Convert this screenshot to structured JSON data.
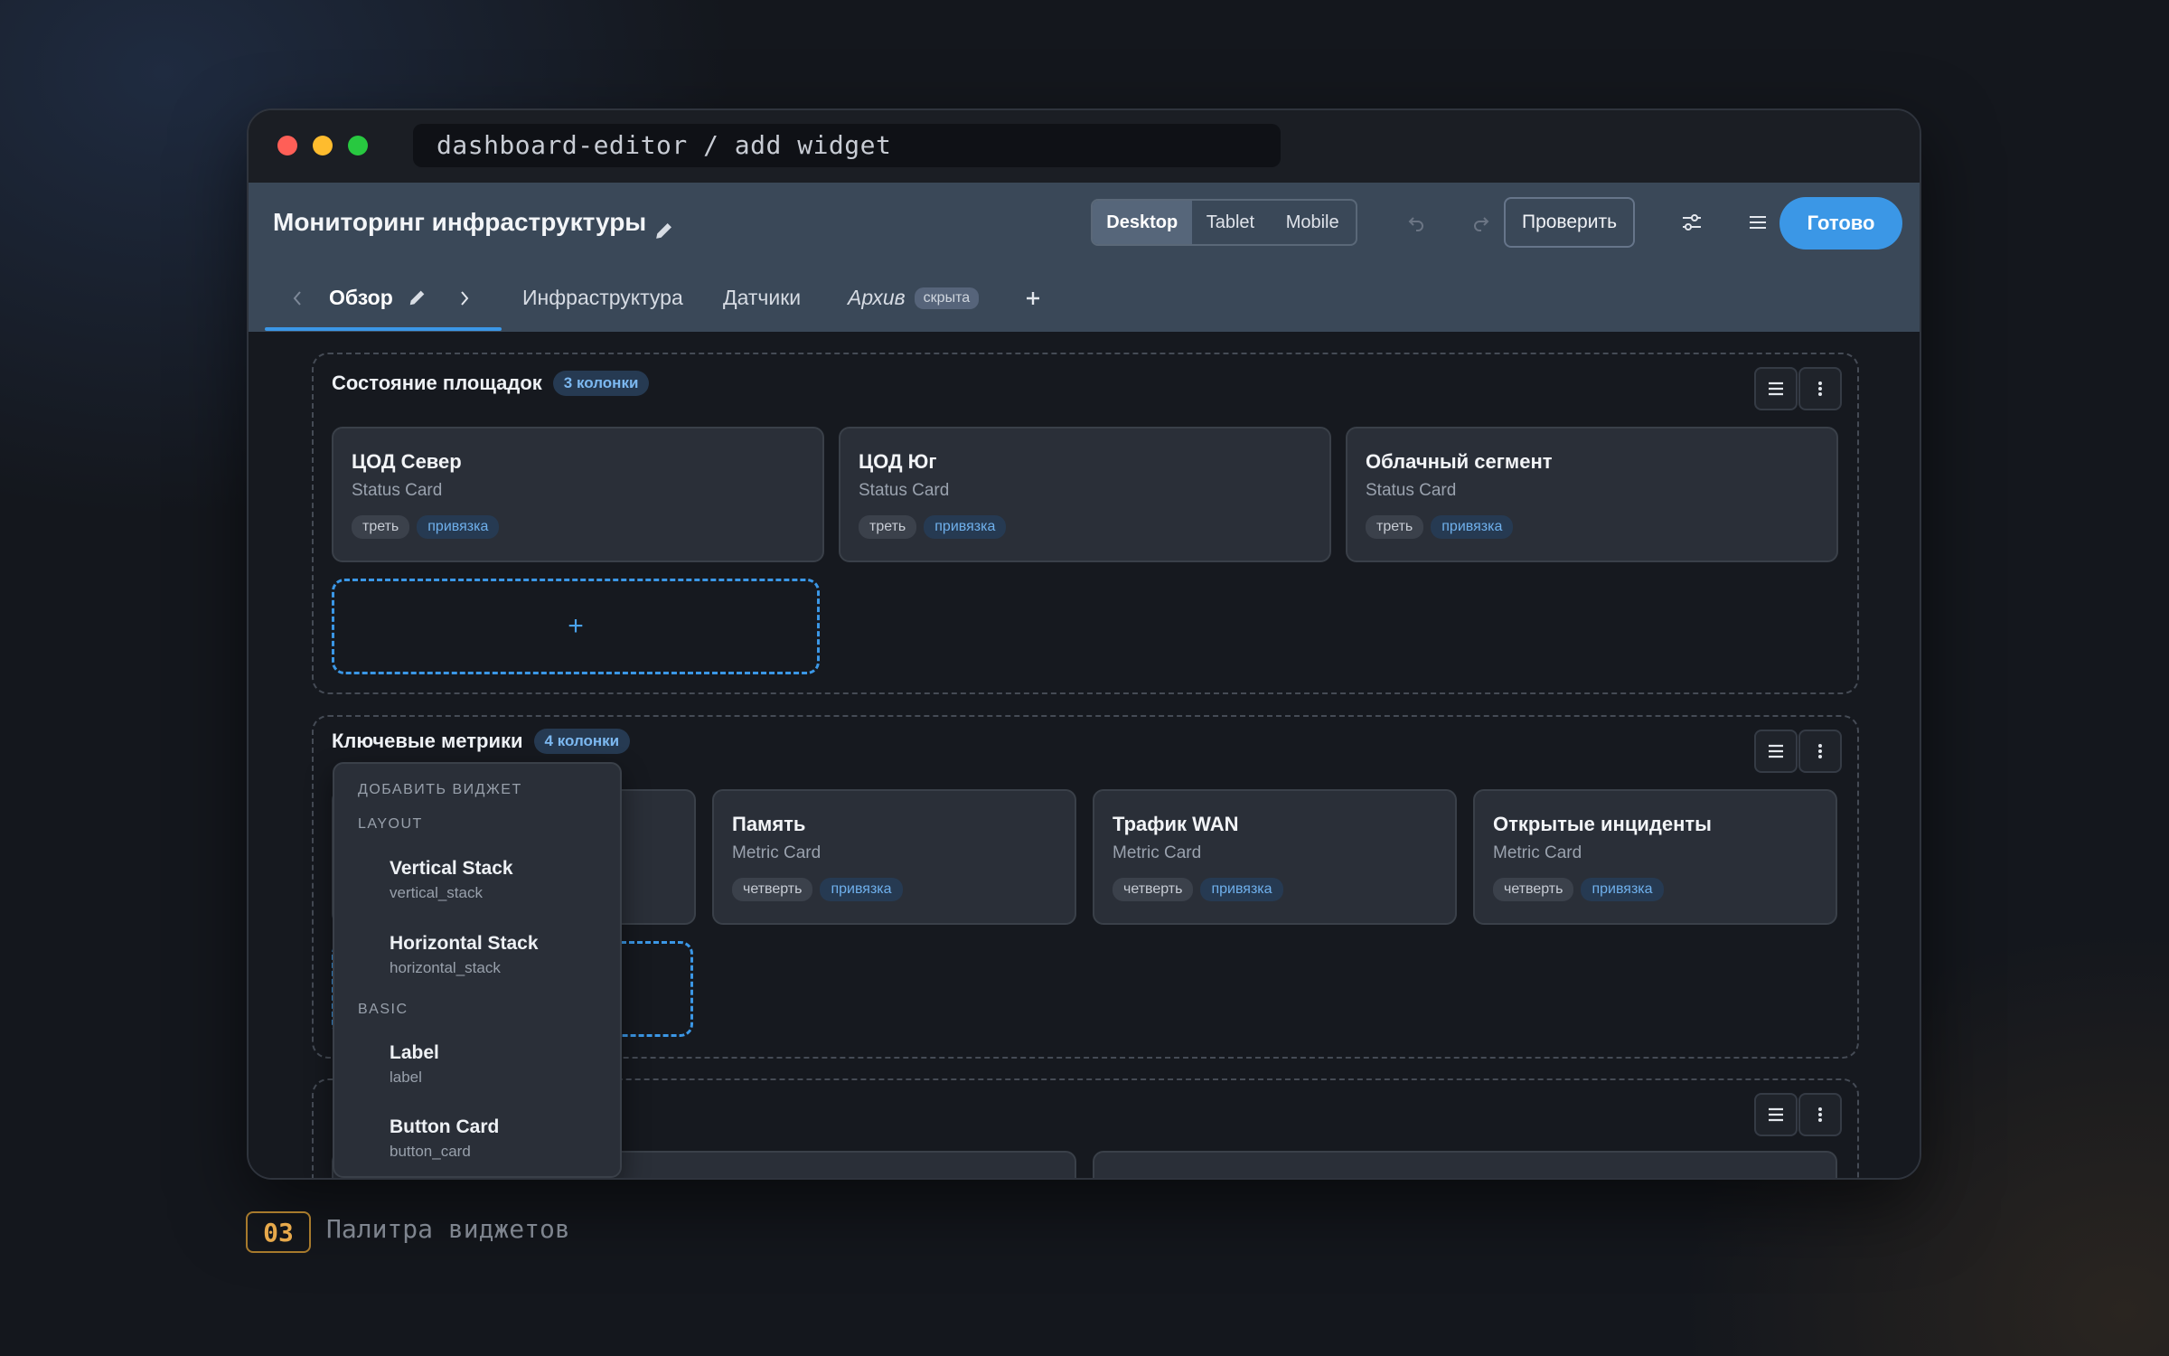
{
  "window": {
    "address": "dashboard-editor / add widget"
  },
  "header": {
    "title": "Мониторинг инфраструктуры",
    "devices": [
      "Desktop",
      "Tablet",
      "Mobile"
    ],
    "check_label": "Проверить",
    "done_label": "Готово"
  },
  "tabs": {
    "active": "Обзор",
    "items": [
      "Инфраструктура",
      "Датчики",
      "Архив"
    ],
    "hidden_badge": "скрыта"
  },
  "sections": [
    {
      "title": "Состояние площадок",
      "badge": "3 колонки",
      "cards": [
        {
          "title": "ЦОД Север",
          "type": "Status Card",
          "size": "треть",
          "binding": "привязка"
        },
        {
          "title": "ЦОД Юг",
          "type": "Status Card",
          "size": "треть",
          "binding": "привязка"
        },
        {
          "title": "Облачный сегмент",
          "type": "Status Card",
          "size": "треть",
          "binding": "привязка"
        }
      ],
      "add": "+"
    },
    {
      "title": "Ключевые метрики",
      "badge": "4 колонки",
      "cards": [
        {
          "title": "Память",
          "type": "Metric Card",
          "size": "четверть",
          "binding": "привязка"
        },
        {
          "title": "Трафик WAN",
          "type": "Metric Card",
          "size": "четверть",
          "binding": "привязка"
        },
        {
          "title": "Открытые инциденты",
          "type": "Metric Card",
          "size": "четверть",
          "binding": "привязка"
        }
      ]
    }
  ],
  "palette": {
    "title": "ДОБАВИТЬ ВИДЖЕТ",
    "groups": [
      {
        "name": "LAYOUT",
        "items": [
          {
            "name": "Vertical Stack",
            "key": "vertical_stack"
          },
          {
            "name": "Horizontal Stack",
            "key": "horizontal_stack"
          }
        ]
      },
      {
        "name": "BASIC",
        "items": [
          {
            "name": "Label",
            "key": "label"
          },
          {
            "name": "Button Card",
            "key": "button_card"
          }
        ]
      }
    ]
  },
  "footer": {
    "number": "03",
    "caption": "Палитра виджетов"
  },
  "colors": {
    "accent": "#3b97e6",
    "header": "#3a4858",
    "background": "#16191f"
  }
}
